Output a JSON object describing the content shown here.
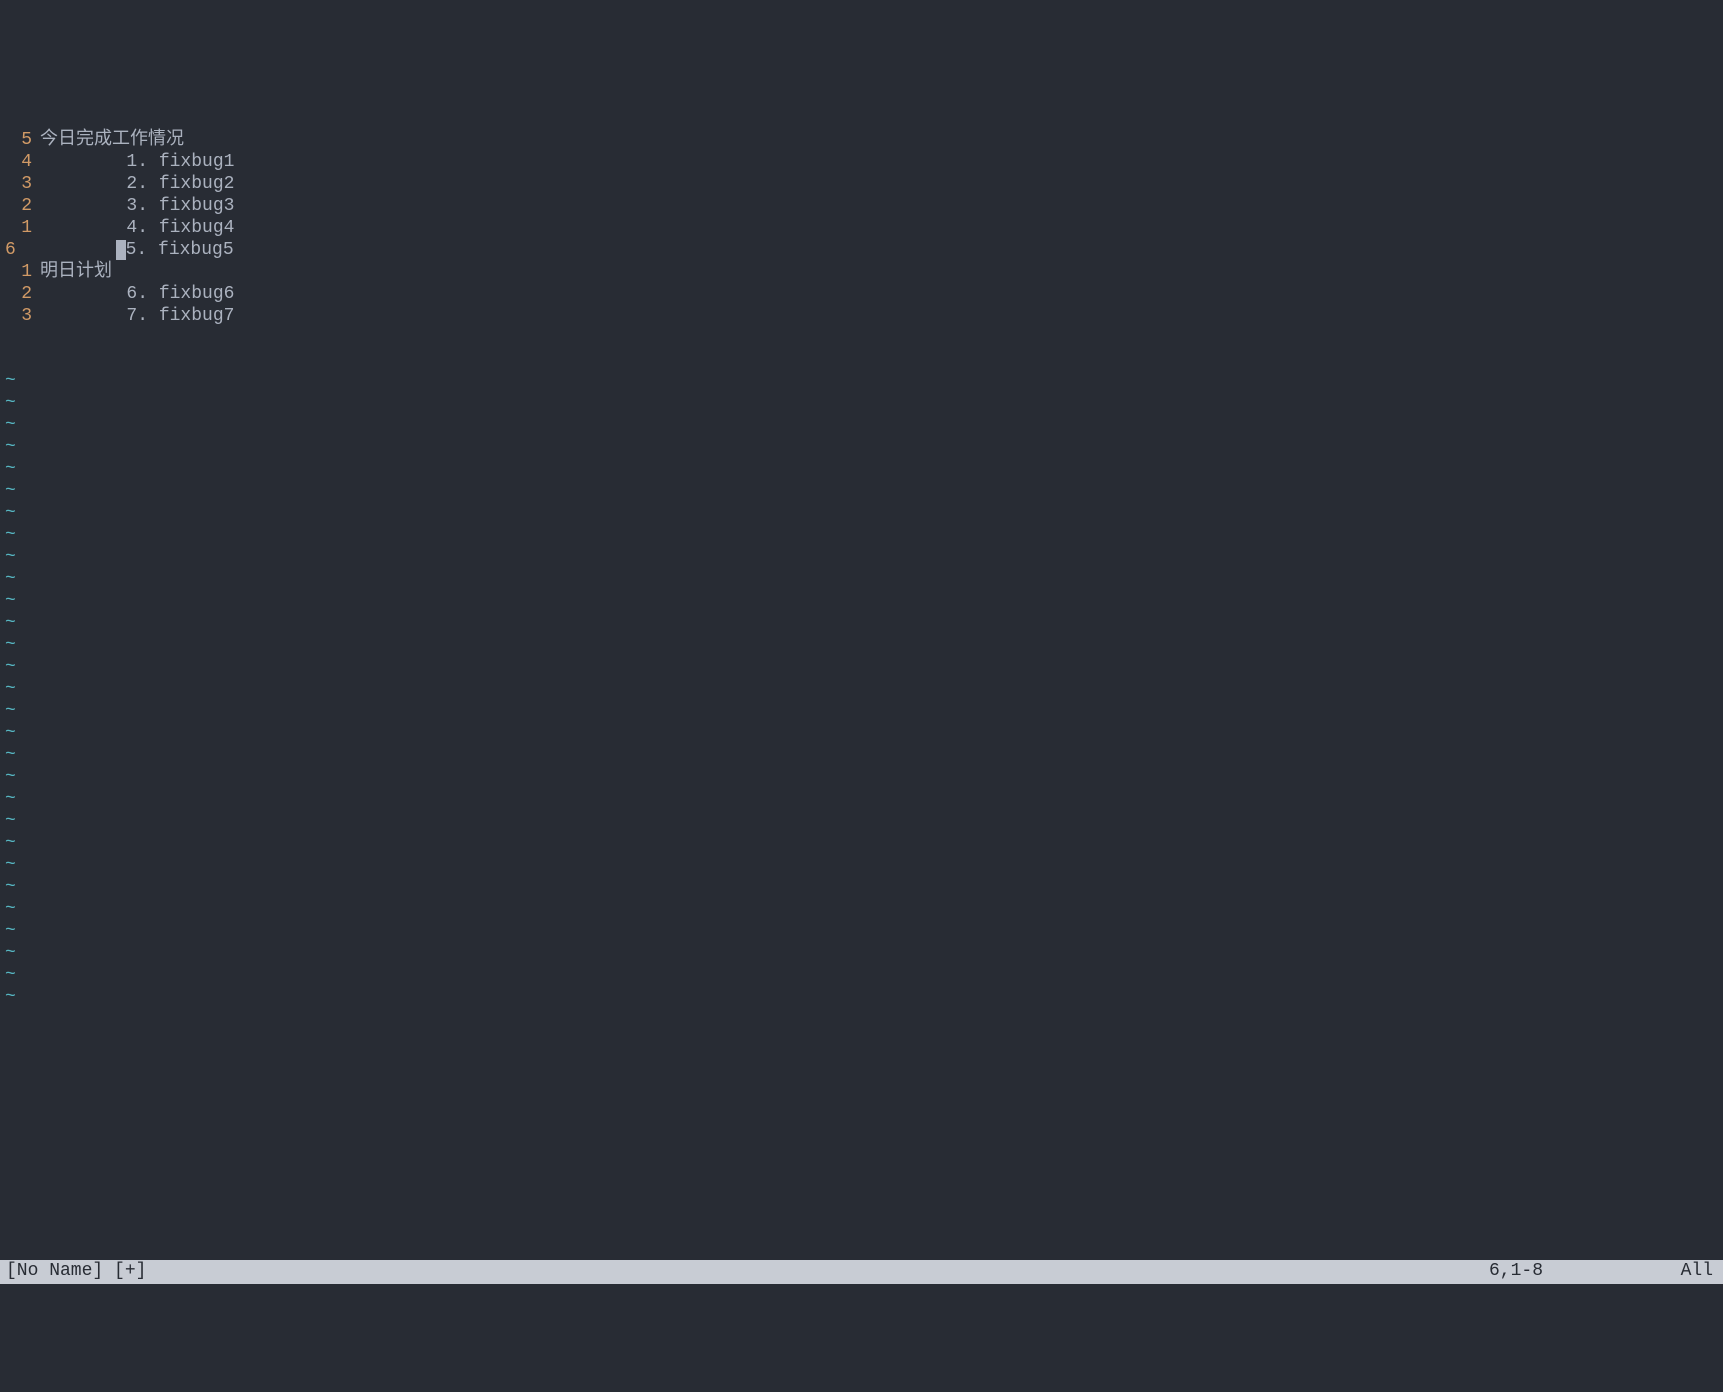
{
  "editor": {
    "lines": [
      {
        "rel": "5",
        "isCurrent": false,
        "indent": "",
        "num": "",
        "text": "今日完成工作情况"
      },
      {
        "rel": "4",
        "isCurrent": false,
        "indent": "        ",
        "num": "1. ",
        "text": "fixbug1"
      },
      {
        "rel": "3",
        "isCurrent": false,
        "indent": "        ",
        "num": "2. ",
        "text": "fixbug2"
      },
      {
        "rel": "2",
        "isCurrent": false,
        "indent": "        ",
        "num": "3. ",
        "text": "fixbug3"
      },
      {
        "rel": "1",
        "isCurrent": false,
        "indent": "        ",
        "num": "4. ",
        "text": "fixbug4"
      },
      {
        "rel": "6",
        "isCurrent": true,
        "indent": "       ",
        "cursor": " ",
        "num": "5. ",
        "text": "fixbug5"
      },
      {
        "rel": "1",
        "isCurrent": false,
        "indent": "",
        "num": "",
        "text": "明日计划"
      },
      {
        "rel": "2",
        "isCurrent": false,
        "indent": "        ",
        "num": "6. ",
        "text": "fixbug6"
      },
      {
        "rel": "3",
        "isCurrent": false,
        "indent": "        ",
        "num": "7. ",
        "text": "fixbug7"
      }
    ],
    "tilde": "~",
    "tildeCount": 29
  },
  "status": {
    "file": "[No Name] [+]",
    "position": "6,1-8",
    "scroll": "All"
  }
}
